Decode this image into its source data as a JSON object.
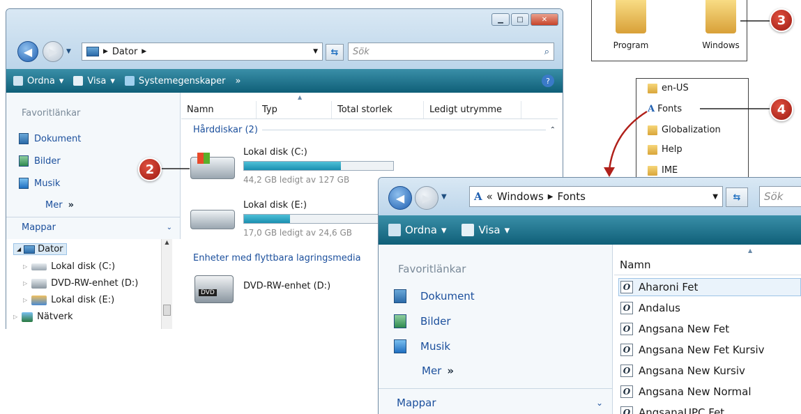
{
  "win1": {
    "address_crumbs": [
      "Dator"
    ],
    "search_placeholder": "Sök",
    "toolbar": {
      "organize": "Ordna",
      "view": "Visa",
      "system_props": "Systemegenskaper",
      "more": "»",
      "help": "?"
    },
    "nav": {
      "favorites_header": "Favoritlänkar",
      "links": [
        "Dokument",
        "Bilder",
        "Musik"
      ],
      "more": "Mer",
      "more_glyph": "»",
      "folders_header": "Mappar",
      "tree": [
        "Dator",
        "Lokal disk (C:)",
        "DVD-RW-enhet (D:)",
        "Lokal disk (E:)",
        "Nätverk"
      ]
    },
    "columns": [
      "Namn",
      "Typ",
      "Total storlek",
      "Ledigt utrymme"
    ],
    "group_hard": "Hårddiskar (2)",
    "disks": [
      {
        "name": "Lokal disk (C:)",
        "free": "44,2 GB ledigt av 127 GB",
        "used_fraction": 0.65
      },
      {
        "name": "Lokal disk (E:)",
        "free": "17,0 GB ledigt av 24,6 GB",
        "used_fraction": 0.31
      }
    ],
    "group_removable": "Enheter med flyttbara lagringsmedia",
    "dvd": {
      "name": "DVD-RW-enhet (D:)",
      "badge": "DVD"
    }
  },
  "folders_panel": {
    "items": [
      "Program",
      "Windows"
    ]
  },
  "tree_panel": {
    "items": [
      "en-US",
      "Fonts",
      "Globalization",
      "Help",
      "IME"
    ]
  },
  "win2": {
    "address_crumbs_prefix": "«",
    "address_crumbs": [
      "Windows",
      "Fonts"
    ],
    "search_placeholder": "Sök",
    "toolbar": {
      "organize": "Ordna",
      "view": "Visa"
    },
    "nav": {
      "favorites_header": "Favoritlänkar",
      "links": [
        "Dokument",
        "Bilder",
        "Musik"
      ],
      "more": "Mer",
      "more_glyph": "»",
      "folders_header": "Mappar"
    },
    "column": "Namn",
    "fonts": [
      "Aharoni Fet",
      "Andalus",
      "Angsana New Fet",
      "Angsana New Fet Kursiv",
      "Angsana New Kursiv",
      "Angsana New Normal",
      "AngsanaUPC Fet"
    ],
    "font_glyph": "O"
  },
  "callouts": [
    "2",
    "3",
    "4"
  ],
  "colors": {
    "toolbar": "#0f5f78",
    "link": "#1b4f9c",
    "callout": "#c0281c"
  }
}
